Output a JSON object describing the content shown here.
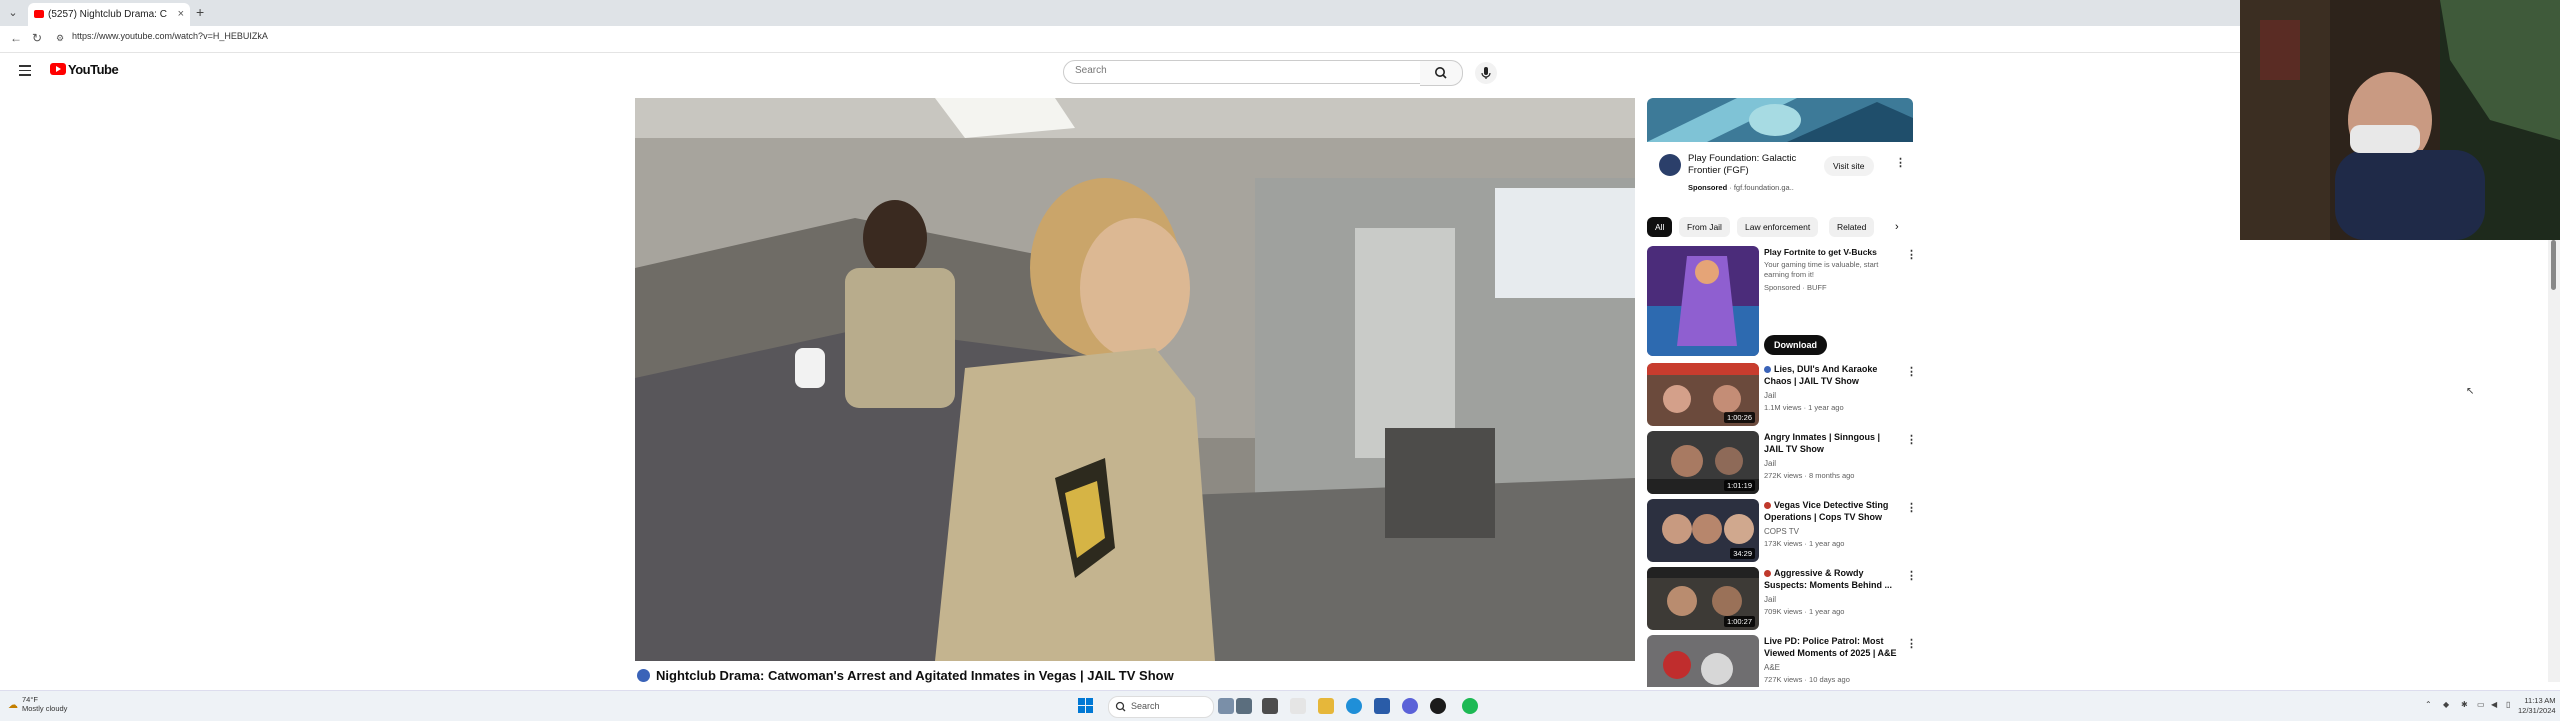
{
  "browser": {
    "tab_title": "(5257) Nightclub Drama: C",
    "tab_close": "×",
    "new_tab": "+",
    "url": "https://www.youtube.com/watch?v=H_HEBUIZkA"
  },
  "youtube": {
    "logo_text": "YouTube",
    "search_placeholder": "Search"
  },
  "video": {
    "title": "Nightclub Drama: Catwoman's Arrest and Agitated Inmates in Vegas | JAIL TV Show"
  },
  "ad": {
    "name": "Play Foundation: Galactic Frontier (FGF)",
    "sponsored_label": "Sponsored",
    "domain": "· fgf.foundation.ga..",
    "visit_label": "Visit site"
  },
  "chips": [
    "All",
    "From Jail",
    "Law enforcement",
    "Related"
  ],
  "recommendations": [
    {
      "title": "Play Fortnite to get V-Bucks",
      "channel": "Your gaming time is valuable, start earning from it!",
      "meta": "Sponsored · BUFF",
      "duration": "",
      "button": "Download"
    },
    {
      "title": "Lies, DUI's And Karaoke Chaos | JAIL TV Show",
      "channel": "Jail",
      "meta": "1.1M views · 1 year ago",
      "duration": "1:00:26"
    },
    {
      "title": "Angry Inmates | Sinngous | JAIL TV Show",
      "channel": "Jail",
      "meta": "272K views · 8 months ago",
      "duration": "1:01:19"
    },
    {
      "title": "Vegas Vice Detective Sting Operations | Cops TV Show",
      "channel": "COPS TV",
      "meta": "173K views · 1 year ago",
      "duration": "34:29"
    },
    {
      "title": "Aggressive & Rowdy Suspects: Moments Behind ...",
      "channel": "Jail",
      "meta": "709K views · 1 year ago",
      "duration": "1:00:27"
    },
    {
      "title": "Live PD: Police Patrol: Most Viewed Moments of 2025 | A&E",
      "channel": "A&E",
      "meta": "727K views · 10 days ago",
      "duration": ""
    }
  ],
  "taskbar": {
    "weather_temp": "74°F",
    "weather_desc": "Mostly cloudy",
    "search_label": "Search",
    "time": "11:13 AM",
    "date": "12/31/2024"
  }
}
